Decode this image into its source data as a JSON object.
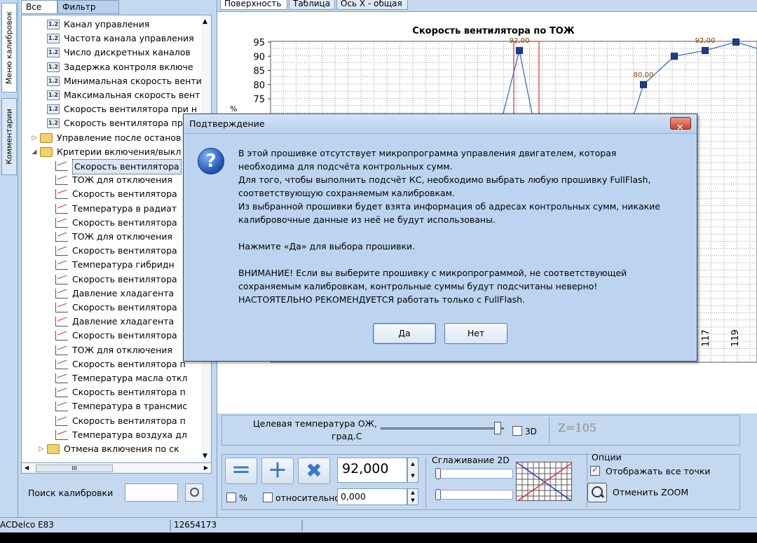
{
  "side_tabs": [
    "Меню калибровок",
    "Комментарии"
  ],
  "left_tabs": {
    "all": "Все",
    "filter": "Фильтр"
  },
  "tree": [
    {
      "indent": 1,
      "icon": "num",
      "label": "Канал управления"
    },
    {
      "indent": 1,
      "icon": "num",
      "label": "Частота канала управления"
    },
    {
      "indent": 1,
      "icon": "num",
      "label": "Число дискретных каналов"
    },
    {
      "indent": 1,
      "icon": "num",
      "label": "Задержка контроля включе"
    },
    {
      "indent": 1,
      "icon": "num",
      "label": "Минимальная скорость венти"
    },
    {
      "indent": 1,
      "icon": "num",
      "label": "Максимальная скорость вент"
    },
    {
      "indent": 1,
      "icon": "num",
      "label": "Скорость вентилятора при н"
    },
    {
      "indent": 1,
      "icon": "num",
      "label": "Скорость вентилятора пр"
    },
    {
      "indent": 0,
      "icon": "folder",
      "label": "Управление после останов",
      "expander": "▷"
    },
    {
      "indent": 0,
      "icon": "folder",
      "label": "Критерии включения/выкл",
      "expander": "◢"
    },
    {
      "indent": 2,
      "icon": "chart",
      "label": "Скорость вентилятора",
      "selected": true
    },
    {
      "indent": 2,
      "icon": "chart",
      "label": "ТОЖ для отключения"
    },
    {
      "indent": 2,
      "icon": "chart",
      "label": "Скорость вентилятора"
    },
    {
      "indent": 2,
      "icon": "chart",
      "label": "Температура в радиат"
    },
    {
      "indent": 2,
      "icon": "chart",
      "label": "Скорость вентилятора"
    },
    {
      "indent": 2,
      "icon": "chart",
      "label": "ТОЖ для отключения"
    },
    {
      "indent": 2,
      "icon": "chart",
      "label": "Скорость вентилятора"
    },
    {
      "indent": 2,
      "icon": "chart",
      "label": "Температура гибридн"
    },
    {
      "indent": 2,
      "icon": "chart",
      "label": "Скорость вентилятора"
    },
    {
      "indent": 2,
      "icon": "chart",
      "label": "Давление хладагента"
    },
    {
      "indent": 2,
      "icon": "chart",
      "label": "Скорость вентилятора"
    },
    {
      "indent": 2,
      "icon": "chart",
      "label": "Давление хладагента"
    },
    {
      "indent": 2,
      "icon": "chart",
      "label": "Скорость вентилятора"
    },
    {
      "indent": 2,
      "icon": "chart",
      "label": "ТОЖ для отключения"
    },
    {
      "indent": 2,
      "icon": "chart",
      "label": "Скорость вентилятора п"
    },
    {
      "indent": 2,
      "icon": "chart",
      "label": "Температура масла откл"
    },
    {
      "indent": 2,
      "icon": "chart",
      "label": "Скорость вентилятора п"
    },
    {
      "indent": 2,
      "icon": "chart",
      "label": "Температура в трансмис"
    },
    {
      "indent": 2,
      "icon": "chart",
      "label": "Скорость вентилятора п"
    },
    {
      "indent": 2,
      "icon": "chart",
      "label": "Температура воздуха дл"
    },
    {
      "indent": 1,
      "icon": "folder",
      "label": "Отмена включения по ск",
      "expander": "▷"
    }
  ],
  "tree_hscroll_thumb": "III",
  "search": {
    "label": "Поиск калибровки",
    "value": ""
  },
  "main_tabs": [
    "Поверхность",
    "Таблица",
    "Ось X - общая"
  ],
  "chart_data": {
    "type": "line",
    "title": "Скорость вентилятора по ТОЖ",
    "ylabel": "%",
    "y_ticks": [
      75,
      80,
      85,
      90,
      95
    ],
    "x_ticks": [
      "117",
      "119"
    ],
    "ylim": [
      74,
      98
    ],
    "grid": true,
    "points": [
      {
        "label": "92,00",
        "y": 92
      },
      {
        "label": "80,00",
        "y": 80
      },
      {
        "label": "",
        "y": 90
      },
      {
        "label": "92,00",
        "y": 92
      },
      {
        "label": "",
        "y": 95
      }
    ],
    "highlight_label": "92,00",
    "line_color": "#3a6fc4",
    "marker_color": "#1a3f8c",
    "highlight_color": "#e03030"
  },
  "axis_control": {
    "label_line1": "Целевая температура ОЖ,",
    "label_line2": "град.С",
    "cb_3d": "3D",
    "z_value": "Z=105"
  },
  "values": {
    "main": "92,000",
    "relative": "0,000",
    "percent_label": "%",
    "relative_label": "относительно"
  },
  "smoothing": {
    "title": "Сглаживание 2D"
  },
  "options": {
    "title": "Опции",
    "show_all_points": "Отображать все точки",
    "cancel_zoom": "Отменить ZOOM"
  },
  "status": {
    "ecu": "ACDelco E83",
    "id": "12654173"
  },
  "dialog": {
    "title": "Подтверждение",
    "close": "✕",
    "paragraphs": [
      "В этой прошивке отсутствует микропрограмма управления двигателем, которая\nнеобходима для подсчёта контрольных сумм.\nДля того, чтобы выполнить подсчёт КС, необходимо выбрать любую прошивку FullFlash,\nсоответствующую сохраняемым калибровкам.\nИз выбранной прошивки будет взята информация об адресах контрольных сумм, никакие\nкалибровочные данные из неё не будут использованы.",
      "Нажмите «Да» для выбора прошивки.",
      "ВНИМАНИЕ! Если вы выберите прошивку с микропрограммой, не соответствующей\nсохраняемым калибровкам, контрольные суммы будут подсчитаны неверно!\nНАСТОЯТЕЛЬНО РЕКОМЕНДУЕТСЯ работать только с FullFlash."
    ],
    "yes": "Да",
    "no": "Нет",
    "icon": "question-icon"
  }
}
